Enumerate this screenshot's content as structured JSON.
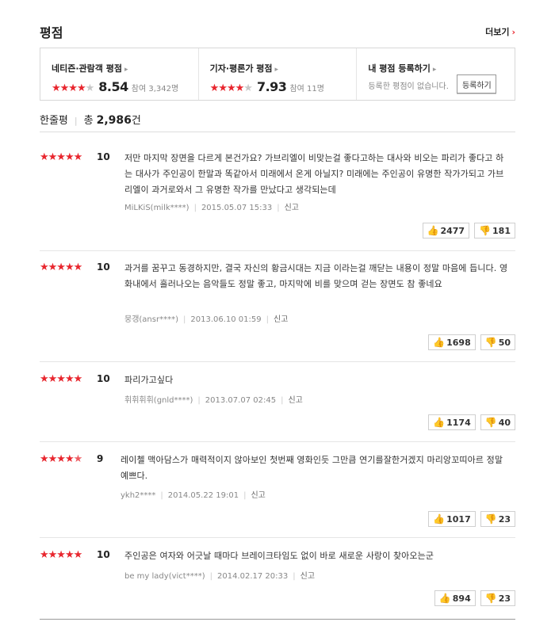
{
  "header": {
    "title": "평점",
    "more_label": "더보기"
  },
  "ratings": {
    "netizen": {
      "title": "네티즌·관람객 평점",
      "stars": "★★★★",
      "stars_off": "★",
      "score": "8.54",
      "count": "참여 3,342명"
    },
    "critic": {
      "title": "기자·평론가 평점",
      "stars": "★★★★",
      "stars_off": "★",
      "score": "7.93",
      "count": "참여 11명"
    },
    "mine": {
      "title": "내 평점 등록하기",
      "text": "등록한 평점이 없습니다.",
      "button": "등록하기"
    }
  },
  "summary": {
    "label": "한줄평",
    "total_prefix": "총",
    "total": "2,986",
    "suffix": "건"
  },
  "reviews": [
    {
      "stars": "★★★★★",
      "score": "10",
      "text": "저만 마지막 장면을 다르게 본건가요? 가브리엘이 비맞는걸 좋다고하는 대사와 비오는 파리가 좋다고 하는 대사가 주인공이 한말과 똑같아서 미래에서 온게 아닐지? 미래에는 주인공이 유명한 작가가되고 가브리엘이 과거로와서 그 유명한 작가를 만났다고 생각되는데",
      "user": "MiLKiS(milk****)",
      "date": "2015.05.07 15:33",
      "report": "신고",
      "like": "2477",
      "dislike": "181"
    },
    {
      "stars": "★★★★★",
      "score": "10",
      "text": "과거를 꿈꾸고 동경하지만, 결국 자신의 황금시대는 지금 이라는걸 깨닫는 내용이 정말 마음에 듭니다. 영화내에서 흘러나오는 음악들도 정말 좋고, 마지막에 비를 맞으며 걷는 장면도 참 좋네요",
      "user": "뭉갱(ansr****)",
      "date": "2013.06.10 01:59",
      "report": "신고",
      "like": "1698",
      "dislike": "50"
    },
    {
      "stars": "★★★★★",
      "score": "10",
      "text": "파리가고싶다",
      "user": "휘휘휘휘(gnld****)",
      "date": "2013.07.07 02:45",
      "report": "신고",
      "like": "1174",
      "dislike": "40"
    },
    {
      "stars": "★★★★",
      "half": "★",
      "score": "9",
      "text": "레이첼 맥아담스가 매력적이지 않아보인 첫번째 영화인듯 그만큼 연기를잘한거겠지 마리앙꼬띠아르 정말예쁘다.",
      "user": "ykh2****",
      "date": "2014.05.22 19:01",
      "report": "신고",
      "like": "1017",
      "dislike": "23"
    },
    {
      "stars": "★★★★★",
      "score": "10",
      "text": "주인공은 여자와 어긋날 때마다 브레이크타임도 없이 바로 새로운 사랑이 찾아오는군",
      "user": "be my lady(vict****)",
      "date": "2014.02.17 20:33",
      "report": "신고",
      "like": "894",
      "dislike": "23"
    }
  ]
}
